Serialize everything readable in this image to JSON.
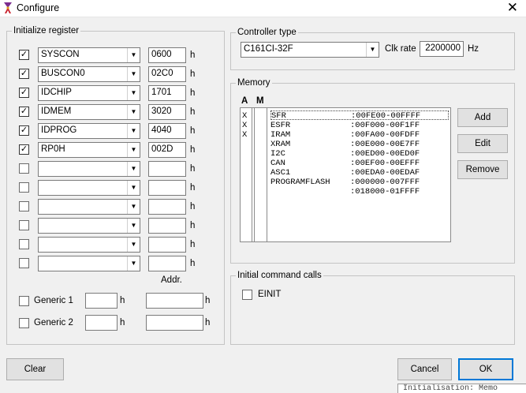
{
  "window": {
    "title": "Configure",
    "close_glyph": "✕"
  },
  "init_register": {
    "legend": "Initialize register",
    "rows": [
      {
        "checked": true,
        "name": "SYSCON",
        "value": "0600",
        "unit": "h"
      },
      {
        "checked": true,
        "name": "BUSCON0",
        "value": "02C0",
        "unit": "h"
      },
      {
        "checked": true,
        "name": "IDCHIP",
        "value": "1701",
        "unit": "h"
      },
      {
        "checked": true,
        "name": "IDMEM",
        "value": "3020",
        "unit": "h"
      },
      {
        "checked": true,
        "name": "IDPROG",
        "value": "4040",
        "unit": "h"
      },
      {
        "checked": true,
        "name": "RP0H",
        "value": "002D",
        "unit": "h"
      },
      {
        "checked": false,
        "name": "",
        "value": "",
        "unit": "h"
      },
      {
        "checked": false,
        "name": "",
        "value": "",
        "unit": "h"
      },
      {
        "checked": false,
        "name": "",
        "value": "",
        "unit": "h"
      },
      {
        "checked": false,
        "name": "",
        "value": "",
        "unit": "h"
      },
      {
        "checked": false,
        "name": "",
        "value": "",
        "unit": "h"
      },
      {
        "checked": false,
        "name": "",
        "value": "",
        "unit": "h"
      }
    ],
    "addr_label": "Addr.",
    "generic": [
      {
        "checked": false,
        "label": "Generic 1",
        "value": "",
        "unit": "h",
        "addr": "",
        "addr_unit": "h"
      },
      {
        "checked": false,
        "label": "Generic 2",
        "value": "",
        "unit": "h",
        "addr": "",
        "addr_unit": "h"
      }
    ]
  },
  "controller": {
    "legend": "Controller type",
    "selected": "C161CI-32F",
    "clk_label": "Clk rate",
    "clk_value": "2200000",
    "clk_unit": "Hz"
  },
  "memory": {
    "legend": "Memory",
    "col_a": "A",
    "col_m": "M",
    "a_marks": [
      "X",
      "X",
      "X"
    ],
    "entries": [
      {
        "name": "SFR",
        "range": ":00FE00-00FFFF"
      },
      {
        "name": "ESFR",
        "range": ":00F000-00F1FF"
      },
      {
        "name": "IRAM",
        "range": ":00FA00-00FDFF"
      },
      {
        "name": "XRAM",
        "range": ":00E000-00E7FF"
      },
      {
        "name": "I2C",
        "range": ":00ED00-00ED0F"
      },
      {
        "name": "CAN",
        "range": ":00EF00-00EFFF"
      },
      {
        "name": "ASC1",
        "range": ":00EDA0-00EDAF"
      },
      {
        "name": "PROGRAMFLASH",
        "range": ":000000-007FFF"
      },
      {
        "name": "",
        "range": ":018000-01FFFF"
      }
    ],
    "buttons": {
      "add": "Add",
      "edit": "Edit",
      "remove": "Remove"
    }
  },
  "init_calls": {
    "legend": "Initial command calls",
    "items": [
      {
        "checked": false,
        "label": "EINIT"
      }
    ]
  },
  "footer": {
    "clear": "Clear",
    "cancel": "Cancel",
    "ok": "OK"
  },
  "background_peek": "Initialisation: Memo"
}
